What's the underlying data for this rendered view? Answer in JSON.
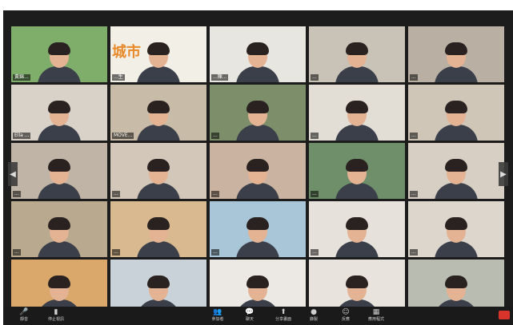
{
  "window": {
    "bg": "#1c1c1c"
  },
  "nav": {
    "prev_icon": "chevron-left-icon",
    "next_icon": "chevron-right-icon"
  },
  "tiles": [
    {
      "label": "黃錦...",
      "bg": "#7fae6a"
    },
    {
      "label": "...生",
      "bg": "#f2efe6",
      "sign": "城市"
    },
    {
      "label": "...陳...",
      "bg": "#e8e6e0"
    },
    {
      "label": "...",
      "bg": "#c9c2b6"
    },
    {
      "label": "...",
      "bg": "#b9b0a3"
    },
    {
      "label": "Ella ...",
      "bg": "#d9d2c8"
    },
    {
      "label": "MOVE...",
      "bg": "#c8bba7"
    },
    {
      "label": "...",
      "bg": "#7c8f6a"
    },
    {
      "label": "...",
      "bg": "#e2ddd5"
    },
    {
      "label": "...",
      "bg": "#cfc6b8"
    },
    {
      "label": "...",
      "bg": "#bfb4a6"
    },
    {
      "label": "...",
      "bg": "#d2c7b8"
    },
    {
      "label": "...",
      "bg": "#cab3a0"
    },
    {
      "label": "...",
      "bg": "#6f8f6a"
    },
    {
      "label": "...",
      "bg": "#d8cfc4"
    },
    {
      "label": "...",
      "bg": "#b9a98f"
    },
    {
      "label": "...",
      "bg": "#d9b98f"
    },
    {
      "label": "...",
      "bg": "#a8c6d8"
    },
    {
      "label": "...",
      "bg": "#e6e1da"
    },
    {
      "label": "...",
      "bg": "#dcd6cc"
    },
    {
      "label": "...",
      "bg": "#d9a86a"
    },
    {
      "label": "Mo...",
      "bg": "#c8d2d8"
    },
    {
      "label": "...",
      "bg": "#ece9e4"
    },
    {
      "label": "...",
      "bg": "#e8e3dd"
    },
    {
      "label": "...",
      "bg": "#b9bdb1"
    }
  ],
  "toolbar": {
    "items": [
      {
        "icon": "microphone-icon",
        "glyph": "🎤",
        "label": "靜音"
      },
      {
        "icon": "camera-icon",
        "glyph": "▮",
        "label": "停止視訊"
      },
      {
        "icon": "participants-icon",
        "glyph": "👥",
        "label": "參加者"
      },
      {
        "icon": "chat-icon",
        "glyph": "💬",
        "label": "聊天"
      },
      {
        "icon": "share-screen-icon",
        "glyph": "⬆",
        "label": "分享畫面"
      },
      {
        "icon": "record-icon",
        "glyph": "●",
        "label": "錄製"
      },
      {
        "icon": "reactions-icon",
        "glyph": "☺",
        "label": "反應"
      },
      {
        "icon": "apps-icon",
        "glyph": "▦",
        "label": "應用程式"
      }
    ],
    "end_color": "#d9342b"
  }
}
